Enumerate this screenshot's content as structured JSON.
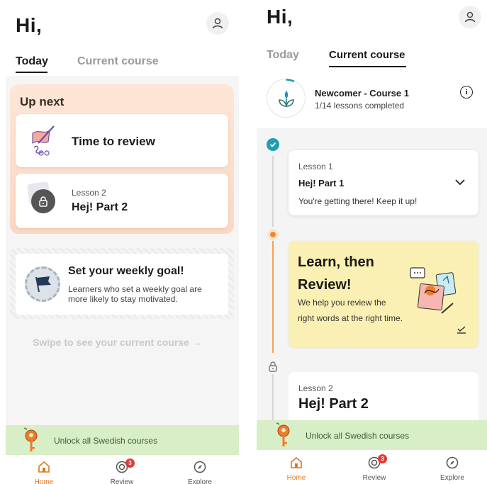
{
  "left": {
    "greeting": "Hi,",
    "tabs": [
      {
        "label": "Today"
      },
      {
        "label": "Current course"
      }
    ],
    "up_next": {
      "title": "Up next",
      "review_label": "Time to review",
      "lesson_sub": "Lesson 2",
      "lesson_title": "Hej! Part 2"
    },
    "goal": {
      "title": "Set your weekly goal!",
      "description": "Learners who set a weekly goal are more likely to stay motivated."
    },
    "swipe_hint": "Swipe to see your current course →",
    "unlock": "Unlock all Swedish courses"
  },
  "right": {
    "greeting": "Hi,",
    "tabs": [
      {
        "label": "Today"
      },
      {
        "label": "Current course"
      }
    ],
    "course": {
      "title": "Newcomer - Course 1",
      "progress": "1/14 lessons completed",
      "info_glyph": "i"
    },
    "lesson1": {
      "sub": "Lesson 1",
      "title": "Hej! Part 1",
      "message": "You're getting there! Keep it up!"
    },
    "learn_review": {
      "title": "Learn, then Review!",
      "description": "We help you review the right words at the right time."
    },
    "lesson2": {
      "sub": "Lesson 2",
      "title": "Hej! Part 2"
    },
    "unlock": "Unlock all Swedish courses"
  },
  "nav": {
    "items": [
      {
        "label": "Home",
        "icon": "home-icon"
      },
      {
        "label": "Review",
        "icon": "review-icon",
        "badge": "3"
      },
      {
        "label": "Explore",
        "icon": "compass-icon"
      }
    ]
  },
  "colors": {
    "accent": "#e2761c",
    "teal": "#1f9eae",
    "unlock_bg": "#d8eec6",
    "up_next_bg": "#fcd7c3",
    "learn_bg": "#fbf0b3",
    "badge": "#e53935"
  }
}
